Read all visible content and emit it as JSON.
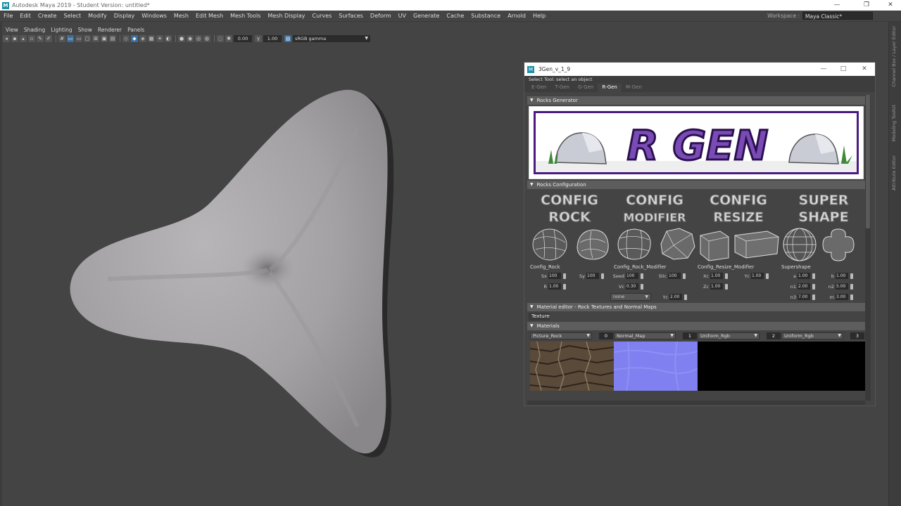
{
  "app": {
    "title": "Autodesk Maya 2019 - Student Version: untitled*",
    "logo": "M",
    "window_controls": [
      "—",
      "❐",
      "✕"
    ]
  },
  "menubar": {
    "items": [
      "File",
      "Edit",
      "Create",
      "Select",
      "Modify",
      "Display",
      "Windows",
      "Mesh",
      "Edit Mesh",
      "Mesh Tools",
      "Mesh Display",
      "Curves",
      "Surfaces",
      "Deform",
      "UV",
      "Generate",
      "Cache",
      "Substance",
      "Arnold",
      "Help"
    ],
    "workspace_label": "Workspace :",
    "workspace_value": "Maya Classic*"
  },
  "panel_menu": [
    "View",
    "Shading",
    "Lighting",
    "Show",
    "Renderer",
    "Panels"
  ],
  "panel_toolbar": {
    "exposure": "0.00",
    "gamma": "1.00",
    "color_space": "sRGB gamma"
  },
  "right_tabs": [
    "Channel Box / Layer Editor",
    "Modeling Toolkit",
    "Attribute Editor"
  ],
  "gen_window": {
    "title": "3Gen_v_1_9",
    "logo": "M",
    "hint": "Select Tool: select an object",
    "tabs": [
      "E-Gen",
      "T-Gen",
      "G-Gen",
      "R-Gen",
      "M-Gen"
    ],
    "active_tab": "R-Gen",
    "section_rocks_generator": "Rocks Generator",
    "banner_text": "R GEN",
    "section_rocks_configuration": "Rocks Configuration",
    "configs": [
      {
        "title_line1": "CONFIG",
        "title_line2": "ROCK",
        "label": "Config_Rock"
      },
      {
        "title_line1": "CONFIG",
        "title_line2": "MODIFIER",
        "label": "Config_Rock_Modifier"
      },
      {
        "title_line1": "CONFIG",
        "title_line2": "RESIZE",
        "label": "Config_Resize_Modifier"
      },
      {
        "title_line1": "SUPER",
        "title_line2": "SHAPE",
        "label": "Supershape"
      }
    ],
    "params": {
      "sx_label": "Sx",
      "sx": "100",
      "sy_label": "Sy",
      "sy": "100",
      "r_label": "R",
      "r": "1.00",
      "seed_label": "Seed",
      "seed": "100",
      "slic_label": "Slic",
      "slic": "100",
      "vc_label": "Vc",
      "vc": "0.30",
      "none_value": "none",
      "yc_label": "Yc",
      "yc": "2.00",
      "xc_label": "Xc",
      "xc": "1.00",
      "yc2_label": "Yc",
      "yc2": "1.00",
      "zc_label": "Zc",
      "zc": "1.00",
      "a_label": "a",
      "a": "1.00",
      "b_label": "b",
      "b": "1.00",
      "n1_label": "n1",
      "n1": "2.00",
      "n2_label": "n2",
      "n2": "5.00",
      "n3_label": "n3",
      "n3": "7.00",
      "m_label": "m",
      "m": "3.00"
    },
    "section_material": "Material editor - Rock Textures and Normal Maps",
    "texture_tab": "Texture",
    "section_materials": "Materials",
    "materials": [
      {
        "name": "Picture_Rock",
        "index": "0"
      },
      {
        "name": "Normal_Map",
        "index": "1"
      },
      {
        "name": "Uniform_Rgb",
        "index": "2"
      },
      {
        "name": "Uniform_Rgb",
        "index": "3"
      }
    ]
  },
  "colors": {
    "maya_blue": "#1f8fa6",
    "viewport_bg": "#444444",
    "rock_base": "#a6a3a6",
    "rgen_purple": "#4a1b80",
    "normal_map": "#8080f0"
  }
}
